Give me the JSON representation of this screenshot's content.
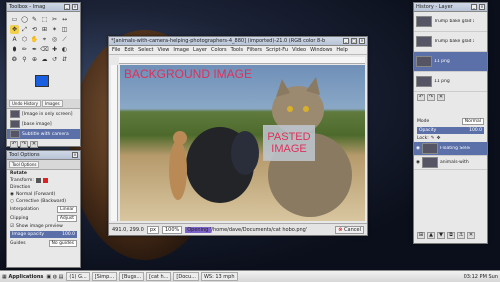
{
  "toolbox": {
    "title": "Toolbox - Imag",
    "tools": [
      "▭",
      "◯",
      "✎",
      "⬚",
      "✂",
      "↔",
      "✥",
      "⤢",
      "⟲",
      "⊞",
      "✶",
      "◫",
      "A",
      "⬡",
      "✋",
      "⌖",
      "◎",
      "⟋",
      "⬮",
      "✏",
      "✒",
      "⌫",
      "✚",
      "◐",
      "❂",
      "⚲",
      "⊕",
      "☁",
      "↺",
      "⇵"
    ],
    "dock_tabs": [
      "Undo History",
      "Images"
    ],
    "history_items": [
      "[Image in only screen]",
      "[base image]"
    ],
    "history_current": "Subtitle with camera"
  },
  "tool_options": {
    "title": "Tool Options",
    "tab": "Tool Options",
    "tool_name": "Rotate",
    "transform_label": "Transform:",
    "direction_label": "Direction",
    "direction_normal": "Normal (Forward)",
    "direction_corrective": "Corrective (Backward)",
    "interpolation_label": "Interpolation",
    "interpolation_value": "Linear",
    "clipping_label": "Clipping",
    "clipping_value": "Adjust",
    "show_preview": "Show image preview",
    "opacity_label": "Image opacity",
    "opacity_value": "100.0",
    "guides_label": "Guides",
    "guides_value": "No guides"
  },
  "image_window": {
    "title": "*[animals-with-camera-helping-photographers-4_880] (imported)-21.0 (RGB color 8-b",
    "menus": [
      "File",
      "Edit",
      "Select",
      "View",
      "Image",
      "Layer",
      "Colors",
      "Tools",
      "Filters",
      "Script-Fu",
      "Video",
      "Windows",
      "Help"
    ],
    "background_label": "BACKGROUND IMAGE",
    "pasted_label": "PASTED IMAGE",
    "status_coords": "491.0, 299.0",
    "status_unit": "px",
    "status_zoom": "100%",
    "status_message": "Opening '/home/dave/Documents/cat hobo.png'",
    "cancel_label": "Cancel"
  },
  "layers": {
    "title": "History - Layer",
    "history_entries": [
      "Trump bake glad ann",
      "Trump bake glad ann",
      "11 png",
      "11 png"
    ],
    "mode_label": "Mode",
    "mode_value": "Normal",
    "opacity_label": "Opacity",
    "opacity_value": "100.0",
    "lock_label": "Lock:",
    "layer_items": [
      "Floating Selec (cat hobo.png)",
      "animals-with"
    ]
  },
  "taskbar": {
    "apps_label": "Applications",
    "tasks": [
      "(1) G...",
      "[Simp...",
      "[Bugs...",
      "[cat h...",
      "[Docu...",
      "WS: 13 mph"
    ],
    "clock": "03:12 PM Sun"
  }
}
